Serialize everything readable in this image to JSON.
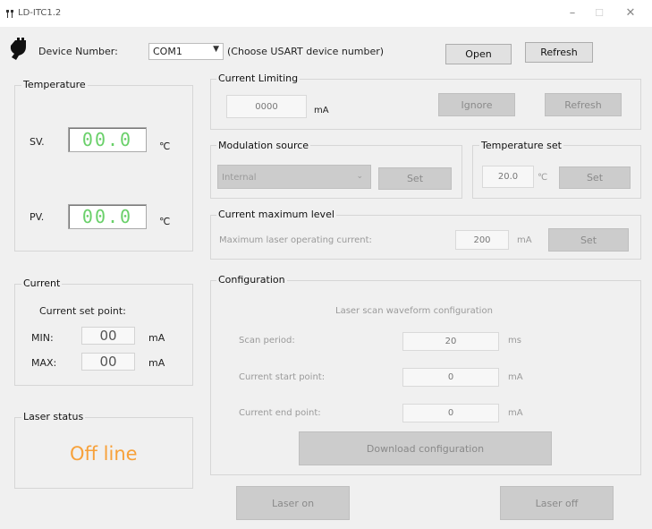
{
  "window": {
    "title": "LD-ITC1.2",
    "minimize": "–",
    "maximize": "☐",
    "close": "✕"
  },
  "device": {
    "label": "Device Number:",
    "selected": "COM1",
    "hint": "(Choose USART device number)",
    "open_label": "Open",
    "refresh_label": "Refresh"
  },
  "temperature": {
    "title": "Temperature",
    "sv_label": "SV.",
    "sv_value": "00.0",
    "sv_unit": "℃",
    "pv_label": "PV.",
    "pv_value": "00.0",
    "pv_unit": "℃"
  },
  "current": {
    "title": "Current",
    "setpoint_label": "Current set point:",
    "min_label": "MIN:",
    "min_value": "00",
    "min_unit": "mA",
    "max_label": "MAX:",
    "max_value": "00",
    "max_unit": "mA"
  },
  "laser_status": {
    "title": "Laser status",
    "value": "Off line",
    "color": "#f7a13a"
  },
  "current_limiting": {
    "title": "Current Limiting",
    "value": "0000",
    "unit": "mA",
    "ignore_label": "Ignore",
    "refresh_label": "Refresh"
  },
  "modulation": {
    "title": "Modulation source",
    "selected": "Internal",
    "set_label": "Set"
  },
  "temperature_set": {
    "title": "Temperature set",
    "value": "20.0",
    "unit": "℃",
    "set_label": "Set"
  },
  "current_max": {
    "title": "Current maximum level",
    "label": "Maximum laser operating current:",
    "value": "200",
    "unit": "mA",
    "set_label": "Set"
  },
  "configuration": {
    "title": "Configuration",
    "subtitle": "Laser scan waveform configuration",
    "scan_period_label": "Scan period:",
    "scan_period_value": "20",
    "scan_period_unit": "ms",
    "start_label": "Current start point:",
    "start_value": "0",
    "start_unit": "mA",
    "end_label": "Current end point:",
    "end_value": "0",
    "end_unit": "mA",
    "download_label": "Download configuration"
  },
  "laser_on_label": "Laser on",
  "laser_off_label": "Laser off"
}
